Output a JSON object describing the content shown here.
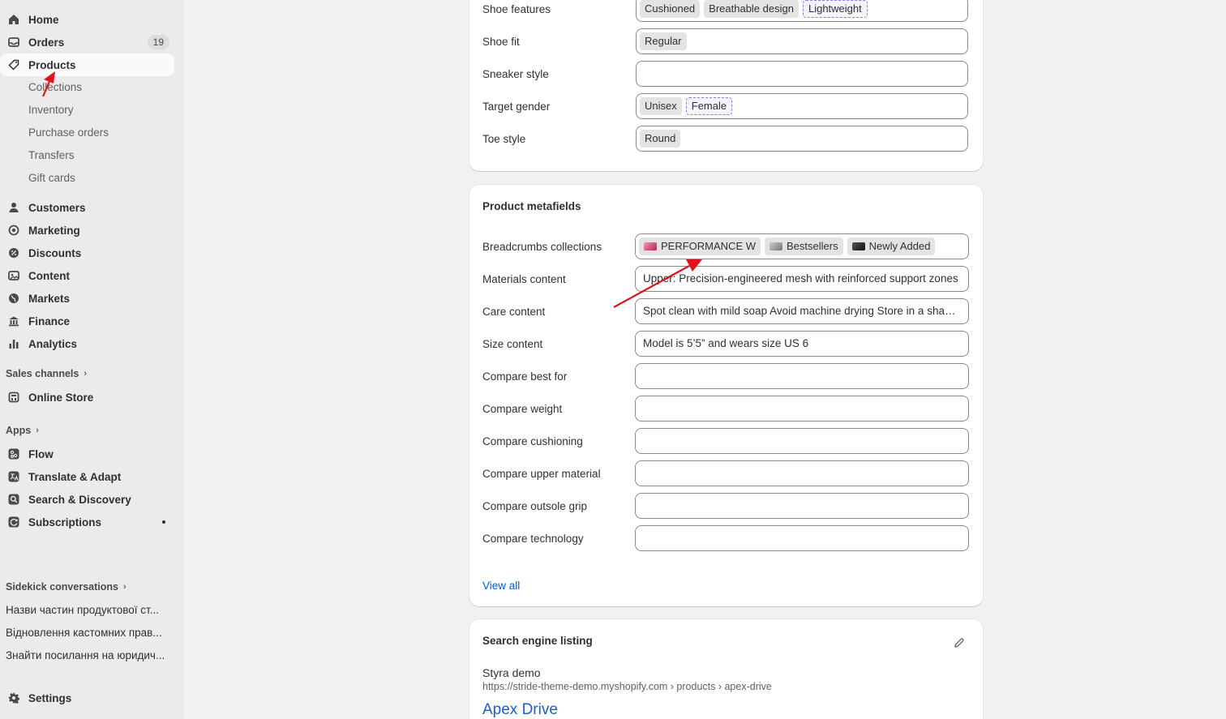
{
  "sidebar": {
    "main": [
      {
        "label": "Home",
        "icon": "home-icon"
      },
      {
        "label": "Orders",
        "icon": "orders-icon",
        "badge": "19"
      },
      {
        "label": "Products",
        "icon": "tag-icon"
      }
    ],
    "product_sub": [
      "Collections",
      "Inventory",
      "Purchase orders",
      "Transfers",
      "Gift cards"
    ],
    "more": [
      {
        "label": "Customers",
        "icon": "person-icon"
      },
      {
        "label": "Marketing",
        "icon": "target-icon"
      },
      {
        "label": "Discounts",
        "icon": "discount-icon"
      },
      {
        "label": "Content",
        "icon": "content-icon"
      },
      {
        "label": "Markets",
        "icon": "globe-icon"
      },
      {
        "label": "Finance",
        "icon": "bank-icon"
      },
      {
        "label": "Analytics",
        "icon": "chart-icon"
      }
    ],
    "sales_channels_label": "Sales channels",
    "online_store": "Online Store",
    "apps_label": "Apps",
    "apps": [
      {
        "label": "Flow",
        "icon": "flow-icon"
      },
      {
        "label": "Translate & Adapt",
        "icon": "translate-icon"
      },
      {
        "label": "Search & Discovery",
        "icon": "search-icon"
      },
      {
        "label": "Subscriptions",
        "icon": "subscriptions-icon"
      }
    ],
    "sidekick_label": "Sidekick conversations",
    "sidekick": [
      "Назви частин продуктової ст...",
      "Відновлення кастомних прав...",
      "Знайти посилання на юридич..."
    ],
    "settings": "Settings"
  },
  "attributes": {
    "rows": [
      {
        "label": "Shoe features",
        "chips": [
          "Cushioned",
          "Breathable design"
        ],
        "suggested": [
          "Lightweight"
        ]
      },
      {
        "label": "Shoe fit",
        "chips": [
          "Regular"
        ],
        "suggested": []
      },
      {
        "label": "Sneaker style",
        "chips": [],
        "suggested": []
      },
      {
        "label": "Target gender",
        "chips": [
          "Unisex"
        ],
        "suggested": [
          "Female"
        ]
      },
      {
        "label": "Toe style",
        "chips": [
          "Round"
        ],
        "suggested": []
      }
    ]
  },
  "metafields": {
    "title": "Product metafields",
    "breadcrumbs_label": "Breadcrumbs collections",
    "collections": [
      {
        "label": "PERFORMANCE W",
        "color": "#d4527a"
      },
      {
        "label": "Bestsellers",
        "color": "#9a9a9a"
      },
      {
        "label": "Newly Added",
        "color": "#2b2b2b"
      }
    ],
    "text_rows": [
      {
        "label": "Materials content",
        "value": "Upper: Precision-engineered mesh with reinforced support zones"
      },
      {
        "label": "Care content",
        "value": "Spot clean with mild soap Avoid machine drying Store in a shaded area"
      },
      {
        "label": "Size content",
        "value": "Model is 5’5” and wears size US 6"
      },
      {
        "label": "Compare best for",
        "value": ""
      },
      {
        "label": "Compare weight",
        "value": ""
      },
      {
        "label": "Compare cushioning",
        "value": ""
      },
      {
        "label": "Compare upper material",
        "value": ""
      },
      {
        "label": "Compare outsole grip",
        "value": ""
      },
      {
        "label": "Compare technology",
        "value": ""
      }
    ],
    "view_all": "View all"
  },
  "seo": {
    "title": "Search engine listing",
    "store_name": "Styra demo",
    "url": "https://stride-theme-demo.myshopify.com › products › apex-drive",
    "page_title": "Apex Drive"
  },
  "colors": {
    "accent": "#005bd3",
    "annotation": "#e0131a"
  }
}
